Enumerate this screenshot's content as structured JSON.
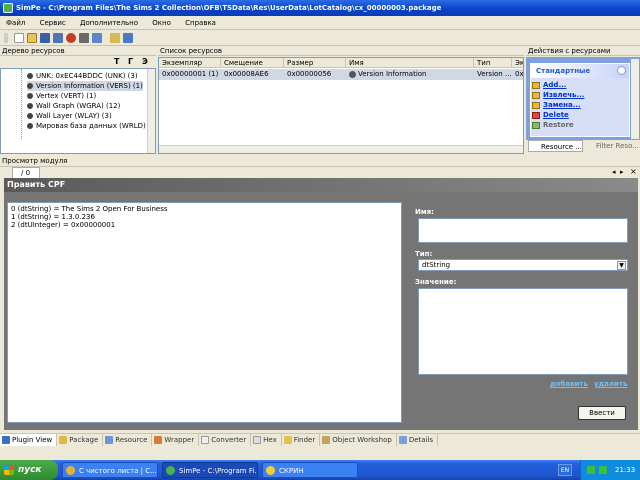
{
  "window": {
    "title": "SimPe - C:\\Program Files\\The Sims 2 Collection\\OFB\\TSData\\Res\\UserData\\LotCatalog\\cx_00000003.package"
  },
  "menu": [
    "Файл",
    "Сервис",
    "Дополнительно",
    "Окно",
    "Справка"
  ],
  "tree": {
    "title": "Дерево ресурсов",
    "filters": [
      "T",
      "Г",
      "Э"
    ],
    "items": [
      "UNK: 0xEC44BDDC (UNK) (3)",
      "Version Information (VERS) (1)",
      "Vertex (VERT) (1)",
      "Wall Graph (WGRA) (12)",
      "Wall Layer (WLAY) (3)",
      "Мировая база данных (WRLD) (1)"
    ]
  },
  "list": {
    "title": "Список ресурсов",
    "headers": [
      "Экземпляр",
      "Смещение",
      "Размер",
      "Имя",
      "Тип",
      "Эк"
    ],
    "row": {
      "instance": "0x00000001 (1)",
      "offset": "0x00008AE6",
      "size": "0x00000056",
      "name": "Version Information",
      "type": "Version ...",
      "extra": "0x"
    }
  },
  "actions": {
    "title": "Действия с ресурсами",
    "box_title": "Стандартные",
    "links": [
      "Add...",
      "Извлечь...",
      "Замена...",
      "Delete",
      "Restore"
    ],
    "tabs": [
      "Resource ...",
      "Filter Reso..."
    ]
  },
  "viewer": {
    "title": "Просмотр модуля",
    "tab": "/ 0",
    "header": "Править CPF",
    "lines": [
      "0 (dtString) = The Sims 2 Open For Business",
      "1 (dtString) = 1.3.0.236",
      "2 (dtUInteger) = 0x00000001"
    ],
    "name_label": "Имя:",
    "type_label": "Тип:",
    "type_value": "dtString",
    "value_label": "Значение:",
    "add_link": "добавить",
    "delete_link": "удалить",
    "submit": "Ввести"
  },
  "bottom_tabs": [
    "Plugin View",
    "Package",
    "Resource",
    "Wrapper",
    "Converter",
    "Hex",
    "Finder",
    "Object Workshop",
    "Details"
  ],
  "taskbar": {
    "start": "пуск",
    "buttons": [
      "С чистого листа | С...",
      "SimPe - C:\\Program Fi...",
      "СКРИН"
    ],
    "lang": "EN",
    "clock": "21:33"
  },
  "colors": {
    "accent": "#0842c6",
    "editor_bg": "#757575",
    "taskbar": "#245edb",
    "start": "#3c9a3c"
  }
}
